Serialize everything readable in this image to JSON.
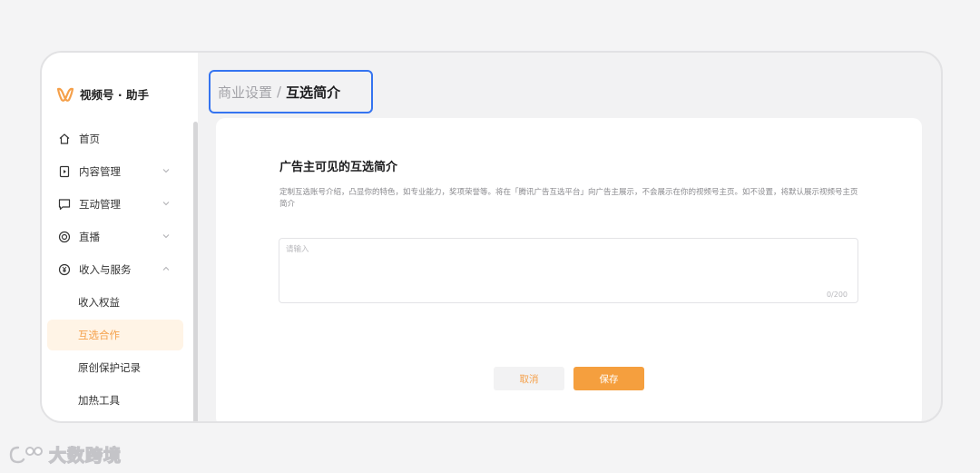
{
  "brand": {
    "name": "视频号 · 助手",
    "color": "#f5a04a"
  },
  "sidebar": {
    "items": [
      {
        "label": "首页",
        "icon": "home-icon"
      },
      {
        "label": "内容管理",
        "icon": "content-icon",
        "expandable": true,
        "expanded": false
      },
      {
        "label": "互动管理",
        "icon": "comment-icon",
        "expandable": true,
        "expanded": false
      },
      {
        "label": "直播",
        "icon": "live-icon",
        "expandable": true,
        "expanded": false
      },
      {
        "label": "收入与服务",
        "icon": "yuan-icon",
        "expandable": true,
        "expanded": true
      }
    ],
    "subitems": [
      {
        "label": "收入权益",
        "active": false
      },
      {
        "label": "互选合作",
        "active": true
      },
      {
        "label": "原创保护记录",
        "active": false
      },
      {
        "label": "加热工具",
        "active": false
      }
    ]
  },
  "breadcrumb": {
    "parent": "商业设置",
    "separator": "/",
    "current": "互选简介"
  },
  "form": {
    "title": "广告主可见的互选简介",
    "description": "定制互选账号介绍，凸显你的特色，如专业能力，奖项荣誉等。将在「腾讯广告互选平台」向广告主展示，不会展示在你的视频号主页。如不设置，将默认展示视频号主页简介",
    "placeholder": "请输入",
    "counter": "0/200",
    "cancel_label": "取消",
    "save_label": "保存"
  },
  "watermark": {
    "text": "大数跨境"
  },
  "colors": {
    "accent": "#f59f3e",
    "highlight": "#3574f0",
    "active_bg": "#fff4e6"
  }
}
